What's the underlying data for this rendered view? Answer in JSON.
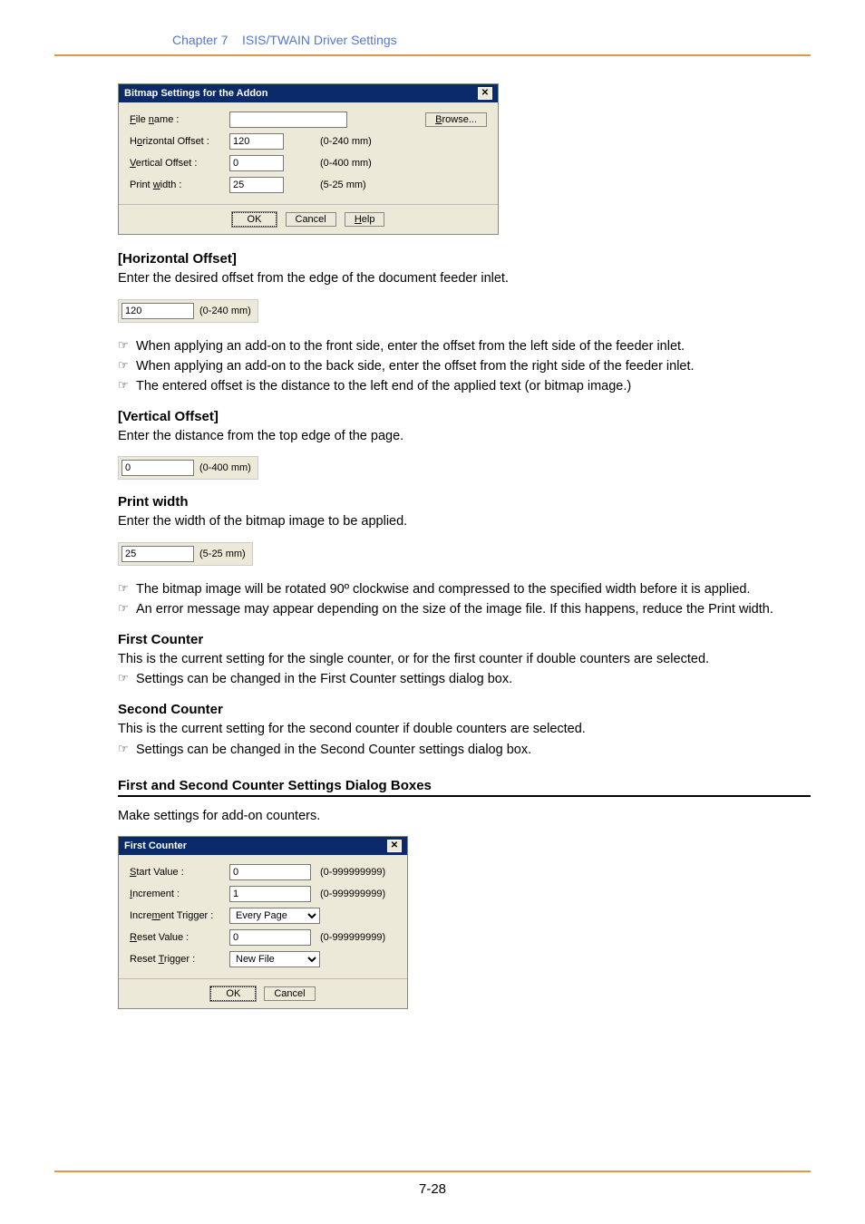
{
  "header": {
    "chapter": "Chapter 7",
    "title": "ISIS/TWAIN Driver Settings"
  },
  "bitmap_dialog": {
    "title": "Bitmap Settings for the Addon",
    "close_glyph": "✕",
    "rows": {
      "filename": {
        "label": "File name :",
        "value": "",
        "browse": "Browse..."
      },
      "hoffset": {
        "label": "Horizontal Offset :",
        "value": "120",
        "range": "(0-240 mm)"
      },
      "voffset": {
        "label": "Vertical Offset :",
        "value": "0",
        "range": "(0-400 mm)"
      },
      "pwidth": {
        "label": "Print width :",
        "value": "25",
        "range": "(5-25 mm)"
      }
    },
    "buttons": {
      "ok": "OK",
      "cancel": "Cancel",
      "help": "Help"
    }
  },
  "hoffset_section": {
    "heading": "[Horizontal Offset]",
    "desc": "Enter the desired offset from the edge of the document feeder inlet.",
    "sample_value": "120",
    "sample_range": "(0-240 mm)",
    "notes": [
      "When applying an add-on to the front side, enter the offset from the left side of the feeder inlet.",
      "When applying an add-on to the back side, enter the offset from the right side of the feeder inlet.",
      "The entered offset is the distance to the left end of the applied text (or bitmap image.)"
    ]
  },
  "voffset_section": {
    "heading": "[Vertical Offset]",
    "desc": "Enter the distance from the top edge of the page.",
    "sample_value": "0",
    "sample_range": "(0-400 mm)"
  },
  "pwidth_section": {
    "heading": "Print width",
    "desc": "Enter the width of the bitmap image to be applied.",
    "sample_value": "25",
    "sample_range": "(5-25 mm)",
    "notes": [
      "The bitmap image will be rotated 90º clockwise and compressed to the specified width before it is applied.",
      "An error message may appear depending on the size of the image file. If this happens, reduce the Print width."
    ]
  },
  "first_counter": {
    "heading": "First Counter",
    "desc": "This is the current setting for the single counter, or for the first counter if double counters are selected.",
    "note": "Settings can be changed in the First Counter settings dialog box."
  },
  "second_counter": {
    "heading": "Second Counter",
    "desc": "This is the current setting for the second counter if double counters are selected.",
    "note": "Settings can be changed in the Second Counter settings dialog box."
  },
  "counter_boxes": {
    "heading": "First and Second Counter Settings Dialog Boxes",
    "desc": "Make settings for add-on counters."
  },
  "counter_dialog": {
    "title": "First Counter",
    "close_glyph": "✕",
    "rows": {
      "start": {
        "label": "Start Value :",
        "value": "0",
        "range": "(0-999999999)"
      },
      "increment": {
        "label": "Increment :",
        "value": "1",
        "range": "(0-999999999)"
      },
      "inc_trigger": {
        "label": "Increment Trigger :",
        "value": "Every Page"
      },
      "reset_value": {
        "label": "Reset Value :",
        "value": "0",
        "range": "(0-999999999)"
      },
      "reset_trigger": {
        "label": "Reset Trigger :",
        "value": "New File"
      }
    },
    "buttons": {
      "ok": "OK",
      "cancel": "Cancel"
    }
  },
  "pointer_glyph": "☞",
  "page_number": "7-28"
}
